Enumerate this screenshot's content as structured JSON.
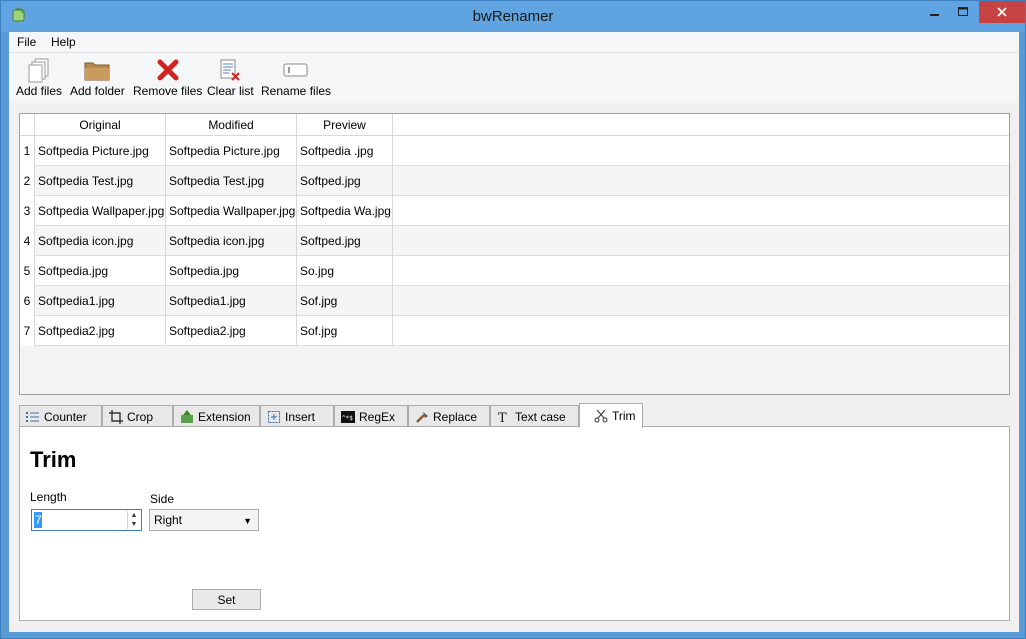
{
  "window": {
    "title": "bwRenamer"
  },
  "menu": [
    "File",
    "Help"
  ],
  "toolbar": [
    {
      "label": "Add files",
      "icon": "add-files-icon"
    },
    {
      "label": "Add folder",
      "icon": "folder-icon"
    },
    {
      "label": "Remove files",
      "icon": "remove-icon"
    },
    {
      "label": "Clear list",
      "icon": "clear-list-icon"
    },
    {
      "label": "Rename files",
      "icon": "rename-icon"
    }
  ],
  "table": {
    "headers": [
      "Original",
      "Modified",
      "Preview"
    ],
    "rows": [
      {
        "num": "1",
        "original": "Softpedia Picture.jpg",
        "modified": "Softpedia Picture.jpg",
        "preview": "Softpedia .jpg"
      },
      {
        "num": "2",
        "original": "Softpedia Test.jpg",
        "modified": "Softpedia Test.jpg",
        "preview": "Softped.jpg"
      },
      {
        "num": "3",
        "original": "Softpedia Wallpaper.jpg",
        "modified": "Softpedia Wallpaper.jpg",
        "preview": "Softpedia Wa.jpg"
      },
      {
        "num": "4",
        "original": "Softpedia icon.jpg",
        "modified": "Softpedia icon.jpg",
        "preview": "Softped.jpg"
      },
      {
        "num": "5",
        "original": "Softpedia.jpg",
        "modified": "Softpedia.jpg",
        "preview": "So.jpg"
      },
      {
        "num": "6",
        "original": "Softpedia1.jpg",
        "modified": "Softpedia1.jpg",
        "preview": "Sof.jpg"
      },
      {
        "num": "7",
        "original": "Softpedia2.jpg",
        "modified": "Softpedia2.jpg",
        "preview": "Sof.jpg"
      }
    ]
  },
  "tabs": [
    {
      "label": "Counter",
      "icon": "counter-icon"
    },
    {
      "label": "Crop",
      "icon": "crop-icon"
    },
    {
      "label": "Extension",
      "icon": "extension-icon"
    },
    {
      "label": "Insert",
      "icon": "insert-icon"
    },
    {
      "label": "RegEx",
      "icon": "regex-icon"
    },
    {
      "label": "Replace",
      "icon": "replace-icon"
    },
    {
      "label": "Text case",
      "icon": "text-case-icon"
    },
    {
      "label": "Trim",
      "icon": "trim-icon",
      "active": true
    }
  ],
  "panel": {
    "title": "Trim",
    "length_label": "Length",
    "length_value": "7",
    "side_label": "Side",
    "side_value": "Right",
    "set_label": "Set"
  },
  "colors": {
    "titlebar": "#5fa3e0",
    "close": "#c74343",
    "selection": "#3399ff"
  }
}
